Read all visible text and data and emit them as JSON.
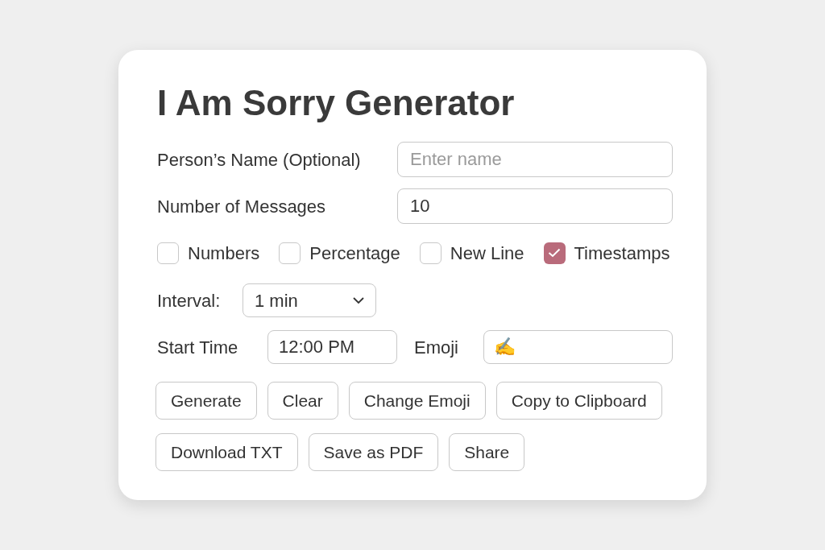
{
  "title": "I Am Sorry Generator",
  "fields": [
    {
      "label": "Person’s Name (Optional)",
      "placeholder": "Enter name"
    },
    {
      "label": "Number of Messages",
      "value": "10"
    }
  ],
  "options": [
    {
      "label": "Numbers",
      "checked": false
    },
    {
      "label": "Percentage",
      "checked": false
    },
    {
      "label": "New Line",
      "checked": false
    },
    {
      "label": "Timestamps",
      "checked": true
    }
  ],
  "interval": {
    "label": "Interval:",
    "value": "1 min"
  },
  "start_time": {
    "label": "Start Time",
    "value": "12:00 PM"
  },
  "emoji": {
    "label": "Emoji",
    "value": "✍"
  },
  "button_rows": [
    [
      "Generate",
      "Clear",
      "Change Emoji",
      "Copy to Clipboard"
    ],
    [
      "Download TXT",
      "Save as PDF",
      "Share"
    ]
  ]
}
